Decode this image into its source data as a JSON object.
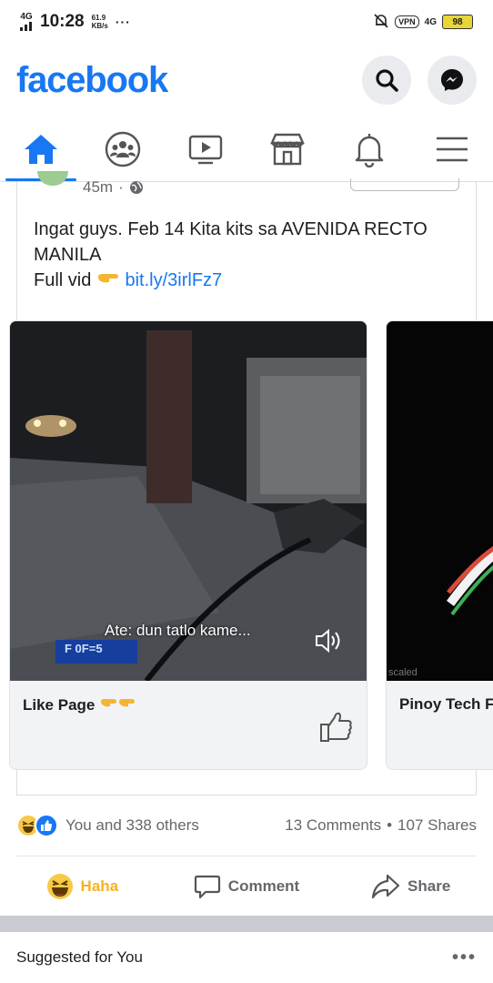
{
  "status_bar": {
    "network": "4G",
    "time": "10:28",
    "speed_value": "61.9",
    "speed_unit": "KB/s",
    "dots": "···",
    "vpn": "VPN",
    "network_right": "4G",
    "battery": "98"
  },
  "header": {
    "logo": "facebook",
    "brand_color": "#1877f2"
  },
  "nav": {
    "items": [
      "home-icon",
      "groups-icon",
      "watch-icon",
      "marketplace-icon",
      "notifications-icon",
      "menu-icon"
    ],
    "active": "home-icon"
  },
  "post": {
    "time": "45m",
    "dot": "·",
    "text_line1": "Ingat guys. Feb 14 Kita kits sa AVENIDA RECTO MANILA",
    "text_line2_prefix": "Full vid",
    "link": "bit.ly/3irlFz7"
  },
  "carousel": {
    "cards": [
      {
        "title": "Like Page",
        "subtitle": "Ate: dun tatlo kame...",
        "dash_text": "F 0F=5"
      },
      {
        "title": "Pinoy Tech F",
        "corner_text": "scaled"
      }
    ]
  },
  "reactions": {
    "summary": "You and 338 others",
    "comments": "13 Comments",
    "separator": "•",
    "shares": "107 Shares"
  },
  "actions": {
    "haha": "Haha",
    "comment": "Comment",
    "share": "Share"
  },
  "suggested": {
    "label": "Suggested for You",
    "more": "•••"
  }
}
